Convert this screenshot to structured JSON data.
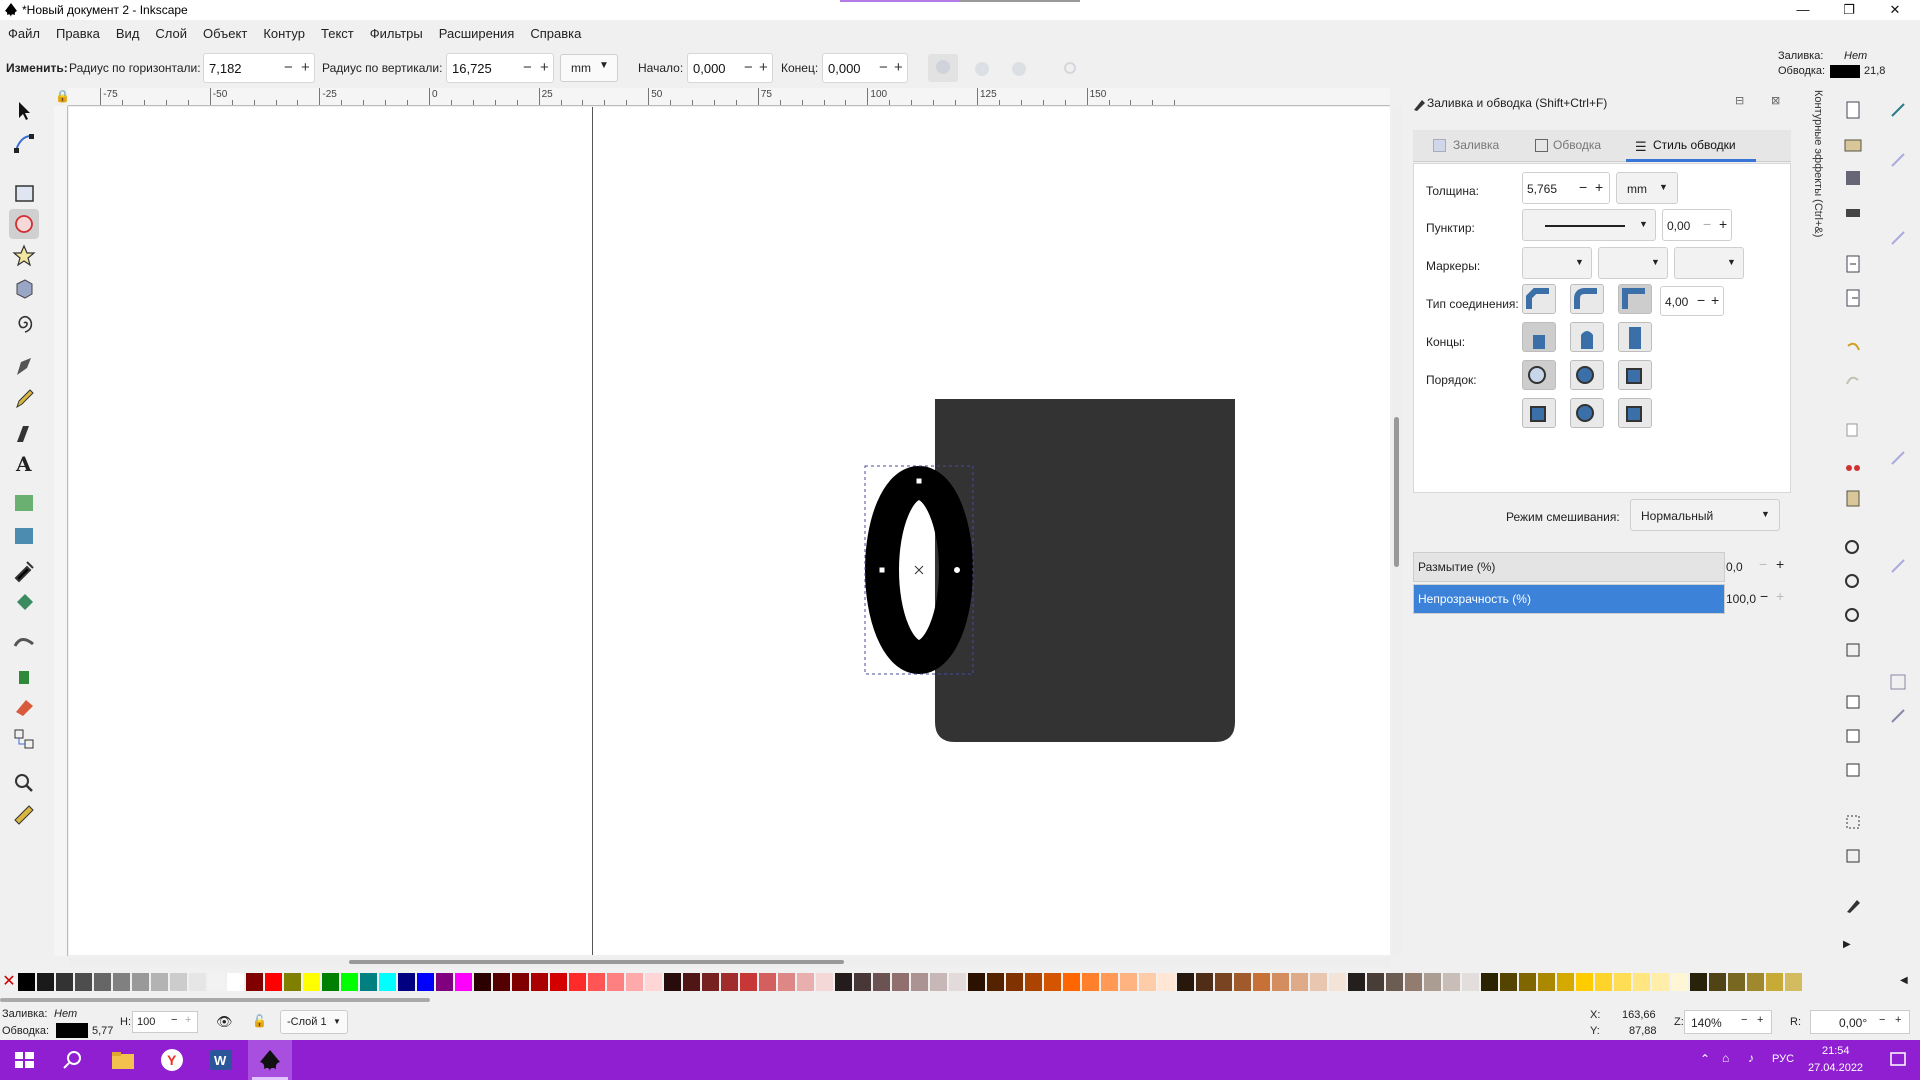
{
  "window": {
    "title": "*Новый документ 2 - Inkscape",
    "minimize": "—",
    "maximize": "❐",
    "close": "✕",
    "progress_percent": 50
  },
  "menu": [
    "Файл",
    "Правка",
    "Вид",
    "Слой",
    "Объект",
    "Контур",
    "Текст",
    "Фильтры",
    "Расширения",
    "Справка"
  ],
  "toolbar": {
    "change_label": "Изменить:",
    "rx_label": "Радиус по горизонтали:",
    "rx_value": "7,182",
    "ry_label": "Радиус по вертикали:",
    "ry_value": "16,725",
    "unit": "mm",
    "start_label": "Начало:",
    "start_value": "0,000",
    "end_label": "Конец:",
    "end_value": "0,000"
  },
  "fill_stroke_indicator": {
    "fill_label": "Заливка:",
    "fill_value": "Нет",
    "stroke_label": "Обводка:",
    "stroke_value": "21,8",
    "stroke_color": "#000000"
  },
  "ruler": {
    "labels": [
      "-75",
      "-50",
      "-25",
      "0",
      "25",
      "50",
      "75",
      "100",
      "125",
      "150"
    ]
  },
  "tools": [
    "selector-icon",
    "node-icon",
    "rectangle-icon",
    "ellipse-icon",
    "star-icon",
    "3d-box-icon",
    "spiral-icon",
    "pen-icon",
    "pencil-icon",
    "calligraphy-icon",
    "text-icon",
    "gradient-icon",
    "mesh-icon",
    "dropper-icon",
    "paint-bucket-icon",
    "tweak-icon",
    "spray-icon",
    "eraser-icon",
    "connector-icon",
    "zoom-icon",
    "measure-icon"
  ],
  "dock": {
    "title": "Заливка и обводка (Shift+Ctrl+F)",
    "vertical_tab": "Контурные эффекты (Ctrl+&)",
    "tabs": [
      "Заливка",
      "Обводка",
      "Стиль обводки"
    ],
    "width_label": "Толщина:",
    "width_value": "5,765",
    "width_unit": "mm",
    "dash_label": "Пунктир:",
    "dash_value": "0,00",
    "markers_label": "Маркеры:",
    "join_label": "Тип соединения:",
    "miter_value": "4,00",
    "caps_label": "Концы:",
    "order_label": "Порядок:",
    "blend_label": "Режим смешивания:",
    "blend_value": "Нормальный",
    "blur_label": "Размытие (%)",
    "blur_value": "0,0",
    "opacity_label": "Непрозрачность (%)",
    "opacity_value": "100,0"
  },
  "status": {
    "fill_label": "Заливка:",
    "fill_value": "Нет",
    "stroke_label": "Обводка:",
    "stroke_value": "5,77",
    "h_label": "Н:",
    "h_value": "100",
    "layer": "-Слой 1",
    "x_label": "X:",
    "x_value": "163,66",
    "y_label": "Y:",
    "y_value": "87,88",
    "zoom_label": "Z:",
    "zoom_value": "140%",
    "rotate_label": "R:",
    "rotate_value": "0,00°"
  },
  "taskbar": {
    "lang": "РУС",
    "time": "21:54",
    "date": "27.04.2022",
    "accent": "#8f1fd0"
  },
  "palette": [
    "#000000",
    "#1a1a1a",
    "#333333",
    "#4d4d4d",
    "#666666",
    "#808080",
    "#999999",
    "#b3b3b3",
    "#cccccc",
    "#e6e6e6",
    "#f2f2f2",
    "#ffffff",
    "#800000",
    "#ff0000",
    "#808000",
    "#ffff00",
    "#008000",
    "#00ff00",
    "#008080",
    "#00ffff",
    "#000080",
    "#0000ff",
    "#800080",
    "#ff00ff",
    "#2b0000",
    "#550000",
    "#800000",
    "#aa0000",
    "#d40000",
    "#ff2a2a",
    "#ff5555",
    "#ff8080",
    "#ffaaaa",
    "#ffd5d5",
    "#280b0b",
    "#501616",
    "#782121",
    "#a02c2c",
    "#c83737",
    "#d35f5f",
    "#de8787",
    "#e9afaf",
    "#f4d7d7",
    "#241c1c",
    "#483737",
    "#6c5353",
    "#916f6f",
    "#ac9393",
    "#c8b7b7",
    "#e3dbdb",
    "#2b1100",
    "#552200",
    "#803300",
    "#aa4400",
    "#d45500",
    "#ff6600",
    "#ff7f2a",
    "#ff9955",
    "#ffb380",
    "#ffccaa",
    "#ffe6d5",
    "#28170b",
    "#502d16",
    "#784421",
    "#a05a2c",
    "#c87137",
    "#d38d5f",
    "#deaa87",
    "#e9c6af",
    "#f4e3d7",
    "#241f1c",
    "#483e37",
    "#6c5d53",
    "#917c6f",
    "#ac9d93",
    "#c8beb7",
    "#e3dedb",
    "#2b2200",
    "#554400",
    "#806600",
    "#aa8800",
    "#d4aa00",
    "#ffcc00",
    "#ffd42a",
    "#ffdd55",
    "#ffe680",
    "#ffeeaa",
    "#fff6d5",
    "#28220b",
    "#504416",
    "#786721",
    "#a0892c",
    "#c8ab37",
    "#d3bc5f"
  ]
}
